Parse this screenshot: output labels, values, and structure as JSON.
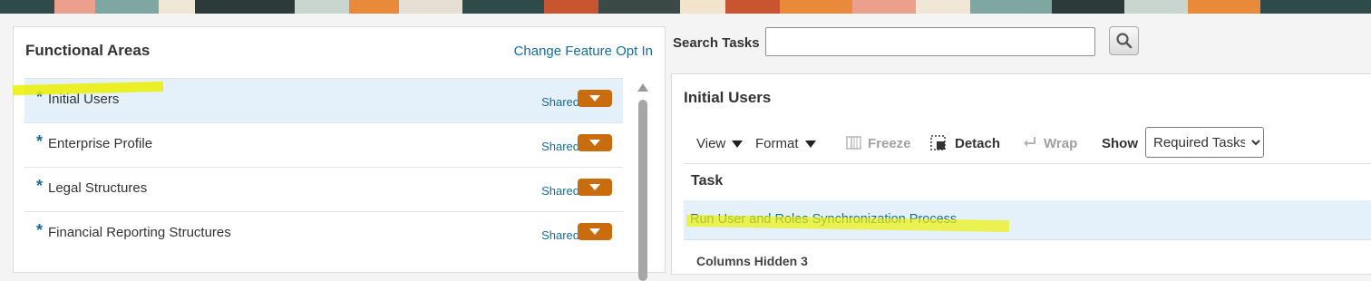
{
  "banner": {
    "colors": [
      "#2e4a4a",
      "#eaa08a",
      "#7fa6a0",
      "#f0e6d6",
      "#2c3b3a",
      "#c9d6cf",
      "#e88a3a",
      "#e6e0d4",
      "#c8552f",
      "#f3e5cd"
    ]
  },
  "functional_areas": {
    "title": "Functional Areas",
    "change_feature_link": "Change Feature Opt In",
    "items": [
      {
        "required_mark": "*",
        "label": "Initial Users",
        "status": "Shared",
        "selected": true
      },
      {
        "required_mark": "*",
        "label": "Enterprise Profile",
        "status": "Shared",
        "selected": false
      },
      {
        "required_mark": "*",
        "label": "Legal Structures",
        "status": "Shared",
        "selected": false
      },
      {
        "required_mark": "*",
        "label": "Financial Reporting Structures",
        "status": "Shared",
        "selected": false
      }
    ]
  },
  "search": {
    "label": "Search Tasks",
    "value": "",
    "placeholder": ""
  },
  "tasks_panel": {
    "title": "Initial Users",
    "toolbar": {
      "view": "View",
      "format": "Format",
      "freeze": "Freeze",
      "detach": "Detach",
      "wrap": "Wrap",
      "show_label": "Show",
      "show_selected": "Required Tasks",
      "show_options": [
        "Required Tasks"
      ]
    },
    "table": {
      "columns": [
        "Task"
      ],
      "rows": [
        {
          "task": "Run User and Roles Synchronization Process"
        }
      ],
      "columns_hidden": "Columns Hidden  3"
    }
  },
  "colors": {
    "link": "#1a6c93",
    "accent_button": "#c86c0e",
    "selected_row": "#e4f1fb",
    "highlight": "#ecf000"
  }
}
